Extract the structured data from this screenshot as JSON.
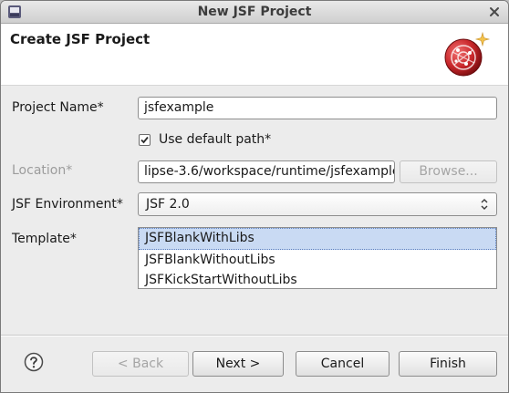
{
  "window": {
    "title": "New JSF Project"
  },
  "banner": {
    "heading": "Create JSF Project"
  },
  "form": {
    "project_name_label": "Project Name*",
    "project_name_value": "jsfexample",
    "use_default_path_label": "Use default path*",
    "use_default_path_checked": true,
    "location_label": "Location*",
    "location_value": "lipse-3.6/workspace/runtime/jsfexample",
    "browse_label": "Browse...",
    "jsf_environment_label": "JSF Environment*",
    "jsf_environment_value": "JSF 2.0",
    "template_label": "Template*",
    "templates": [
      "JSFBlankWithLibs",
      "JSFBlankWithoutLibs",
      "JSFKickStartWithoutLibs"
    ],
    "selected_template": "JSFBlankWithLibs"
  },
  "buttons": {
    "back": "< Back",
    "next": "Next >",
    "cancel": "Cancel",
    "finish": "Finish"
  },
  "icons": {
    "app": "eclipse-icon",
    "close": "close-icon",
    "banner": "jsf-wizard-logo-icon",
    "help": "help-icon"
  },
  "colors": {
    "selection": "#c9daf3",
    "logo_red": "#c8262a"
  }
}
